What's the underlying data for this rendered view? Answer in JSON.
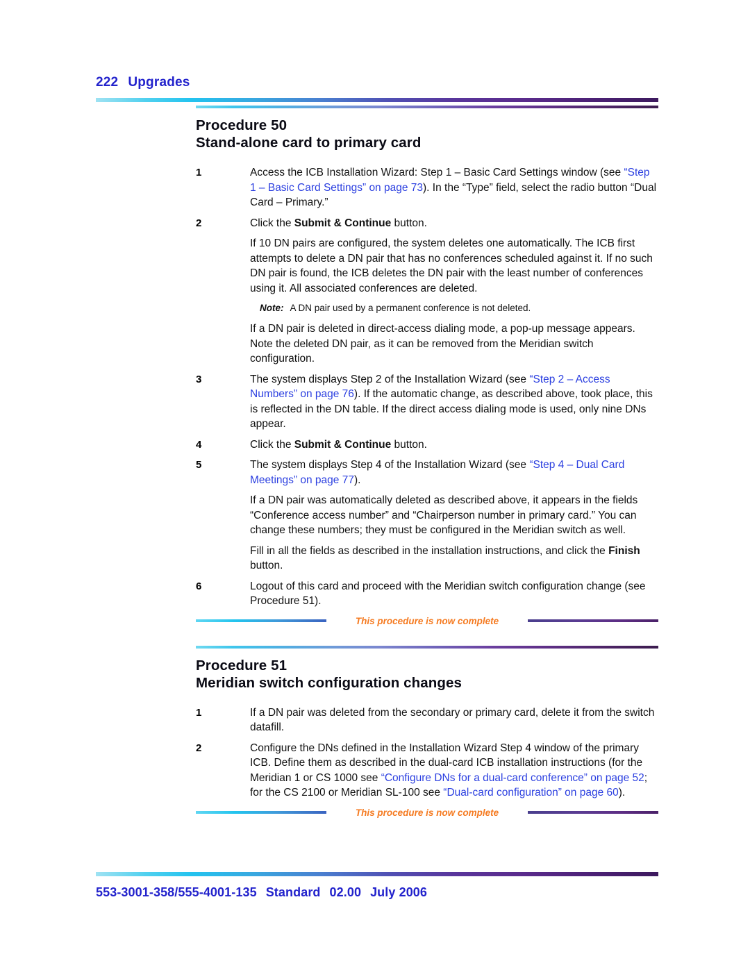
{
  "header": {
    "page_number": "222",
    "section_title": "Upgrades"
  },
  "procedures": [
    {
      "label": "Procedure 50",
      "title": "Stand-alone card to primary card",
      "steps": [
        {
          "number": "1",
          "paragraphs": [
            {
              "runs": [
                {
                  "text": "Access the ICB Installation Wizard: Step 1 – Basic Card Settings window (see ",
                  "style": "normal"
                },
                {
                  "text": "“Step 1 – Basic Card Settings” on page 73",
                  "style": "link"
                },
                {
                  "text": "). In the “Type” field, select the radio button “Dual Card – Primary.”",
                  "style": "normal"
                }
              ]
            }
          ]
        },
        {
          "number": "2",
          "paragraphs": [
            {
              "runs": [
                {
                  "text": "Click the ",
                  "style": "normal"
                },
                {
                  "text": "Submit & Continue",
                  "style": "bold"
                },
                {
                  "text": " button.",
                  "style": "normal"
                }
              ]
            }
          ]
        },
        {
          "number": "",
          "continuation": true,
          "paragraphs": [
            {
              "runs": [
                {
                  "text": "If 10 DN pairs are configured, the system deletes one automatically. The ICB first attempts to delete a DN pair that has no conferences scheduled against it. If no such DN pair is found, the ICB deletes the DN pair with the least number of conferences using it. All associated conferences are deleted.",
                  "style": "normal"
                }
              ]
            }
          ]
        },
        {
          "number": "",
          "note": true,
          "note_label": "Note:",
          "note_text": "A DN pair used by a permanent conference is not deleted."
        },
        {
          "number": "",
          "continuation": true,
          "paragraphs": [
            {
              "runs": [
                {
                  "text": "If a DN pair is deleted in direct-access dialing mode, a pop-up message appears. Note the deleted DN pair, as it can be removed from the Meridian switch configuration.",
                  "style": "normal"
                }
              ]
            }
          ]
        },
        {
          "number": "3",
          "paragraphs": [
            {
              "runs": [
                {
                  "text": "The system displays Step 2 of the Installation Wizard (see ",
                  "style": "normal"
                },
                {
                  "text": "“Step 2 – Access Numbers” on page 76",
                  "style": "link"
                },
                {
                  "text": "). If the automatic change, as described above, took place, this is reflected in the DN table. If the direct access dialing mode is used, only nine DNs appear.",
                  "style": "normal"
                }
              ]
            }
          ]
        },
        {
          "number": "4",
          "paragraphs": [
            {
              "runs": [
                {
                  "text": "Click the ",
                  "style": "normal"
                },
                {
                  "text": "Submit & Continue",
                  "style": "bold"
                },
                {
                  "text": " button.",
                  "style": "normal"
                }
              ]
            }
          ]
        },
        {
          "number": "5",
          "paragraphs": [
            {
              "runs": [
                {
                  "text": "The system displays Step 4 of the Installation Wizard (see ",
                  "style": "normal"
                },
                {
                  "text": "“Step 4 – Dual Card Meetings” on page 77",
                  "style": "link"
                },
                {
                  "text": ").",
                  "style": "normal"
                }
              ]
            }
          ]
        },
        {
          "number": "",
          "continuation": true,
          "paragraphs": [
            {
              "runs": [
                {
                  "text": "If a DN pair was automatically deleted as described above, it appears in the fields “Conference access number” and “Chairperson number in primary card.” You can change these numbers; they must be configured in the Meridian switch as well.",
                  "style": "normal"
                }
              ]
            }
          ]
        },
        {
          "number": "",
          "continuation": true,
          "paragraphs": [
            {
              "runs": [
                {
                  "text": "Fill in all the fields as described in the installation instructions, and click the ",
                  "style": "normal"
                },
                {
                  "text": "Finish",
                  "style": "bold"
                },
                {
                  "text": " button.",
                  "style": "normal"
                }
              ]
            }
          ]
        },
        {
          "number": "6",
          "paragraphs": [
            {
              "runs": [
                {
                  "text": "Logout of this card and proceed with the Meridian switch configuration change (see Procedure 51).",
                  "style": "normal"
                }
              ]
            }
          ]
        }
      ],
      "complete_banner": "This procedure is now complete"
    },
    {
      "label": "Procedure 51",
      "title": "Meridian switch configuration changes",
      "steps": [
        {
          "number": "1",
          "paragraphs": [
            {
              "runs": [
                {
                  "text": "If a DN pair was deleted from the secondary or primary card, delete it from the switch datafill.",
                  "style": "normal"
                }
              ]
            }
          ]
        },
        {
          "number": "2",
          "paragraphs": [
            {
              "runs": [
                {
                  "text": "Configure the DNs defined in the Installation Wizard Step 4 window of the primary ICB. Define them as described in the dual-card ICB installation instructions (for the Meridian 1 or CS 1000 see ",
                  "style": "normal"
                },
                {
                  "text": "“Configure DNs for a dual-card conference” on page 52",
                  "style": "link"
                },
                {
                  "text": "; for the CS 2100 or Meridian SL-100 see ",
                  "style": "normal"
                },
                {
                  "text": "“Dual-card configuration” on page 60",
                  "style": "link"
                },
                {
                  "text": ").",
                  "style": "normal"
                }
              ]
            }
          ]
        }
      ],
      "complete_banner": "This procedure is now complete"
    }
  ],
  "footer": {
    "document_number": "553-3001-358/555-4001-135",
    "status": "Standard",
    "version": "02.00",
    "date": "July 2006"
  },
  "colors": {
    "accent_blue": "#2222cc",
    "link_blue": "#2b3fe0",
    "banner_orange": "#f57a20",
    "heading_black": "#0a0a14",
    "rule_start": "#9fe2f2",
    "rule_end": "#3d1a5e"
  }
}
